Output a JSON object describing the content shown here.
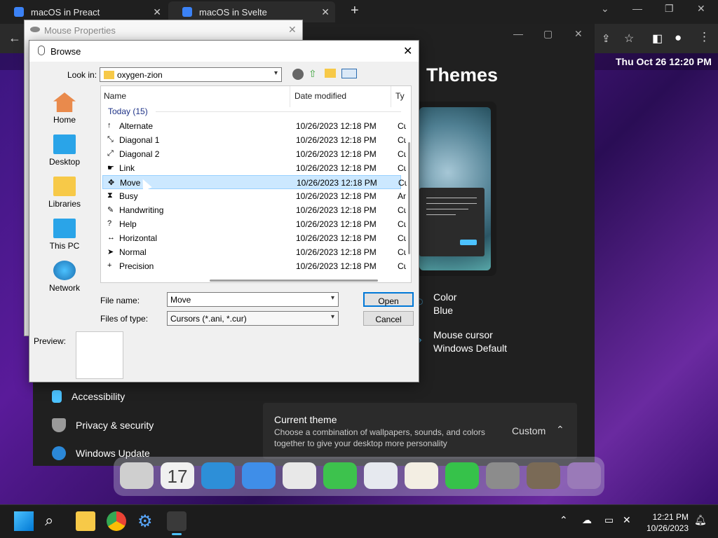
{
  "browser": {
    "tabs": [
      {
        "label": "macOS in Preact"
      },
      {
        "label": "macOS in Svelte"
      }
    ],
    "new_tab": "+"
  },
  "menubar": {
    "datetime": "Thu Oct 26  12:20 PM"
  },
  "settings": {
    "page_title": "Themes",
    "color_label": "Color",
    "color_value": "Blue",
    "cursor_label": "Mouse cursor",
    "cursor_value": "Windows Default",
    "sidebar": [
      {
        "label": "Accessibility"
      },
      {
        "label": "Privacy & security"
      },
      {
        "label": "Windows Update"
      }
    ],
    "current_theme": {
      "title": "Current theme",
      "description_line1": "Choose a combination of wallpapers, sounds, and colors",
      "description_line2": "together to give your desktop more personality",
      "value": "Custom"
    }
  },
  "dock": {
    "calendar_day": "17"
  },
  "mouse_properties": {
    "title": "Mouse Properties"
  },
  "dialog": {
    "title": "Browse",
    "look_in_label": "Look in:",
    "look_in_value": "oxygen-zion",
    "places": [
      {
        "label": "Home"
      },
      {
        "label": "Desktop"
      },
      {
        "label": "Libraries"
      },
      {
        "label": "This PC"
      },
      {
        "label": "Network"
      }
    ],
    "columns": {
      "name": "Name",
      "date": "Date modified",
      "type": "Ty"
    },
    "group": "Today (15)",
    "files": [
      {
        "name": "Alternate",
        "icon": "↑",
        "date": "10/26/2023 12:18 PM",
        "type": "Cu"
      },
      {
        "name": "Diagonal 1",
        "icon": "⤡",
        "date": "10/26/2023 12:18 PM",
        "type": "Cu"
      },
      {
        "name": "Diagonal 2",
        "icon": "⤢",
        "date": "10/26/2023 12:18 PM",
        "type": "Cu"
      },
      {
        "name": "Link",
        "icon": "☛",
        "date": "10/26/2023 12:18 PM",
        "type": "Cu"
      },
      {
        "name": "Move",
        "icon": "✥",
        "date": "10/26/2023 12:18 PM",
        "type": "Cu"
      },
      {
        "name": "Busy",
        "icon": "⧗",
        "date": "10/26/2023 12:18 PM",
        "type": "An"
      },
      {
        "name": "Handwriting",
        "icon": "✎",
        "date": "10/26/2023 12:18 PM",
        "type": "Cu"
      },
      {
        "name": "Help",
        "icon": "?",
        "date": "10/26/2023 12:18 PM",
        "type": "Cu"
      },
      {
        "name": "Horizontal",
        "icon": "↔",
        "date": "10/26/2023 12:18 PM",
        "type": "Cu"
      },
      {
        "name": "Normal",
        "icon": "➤",
        "date": "10/26/2023 12:18 PM",
        "type": "Cu"
      },
      {
        "name": "Precision",
        "icon": "+",
        "date": "10/26/2023 12:18 PM",
        "type": "Cu"
      }
    ],
    "selected_file": "Move",
    "file_name_label": "File name:",
    "file_name_value": "Move",
    "file_type_label": "Files of type:",
    "file_type_value": "Cursors (*.ani, *.cur)",
    "open_button": "Open",
    "cancel_button": "Cancel",
    "preview_label": "Preview:"
  },
  "taskbar": {
    "time": "12:21 PM",
    "date": "10/26/2023"
  }
}
